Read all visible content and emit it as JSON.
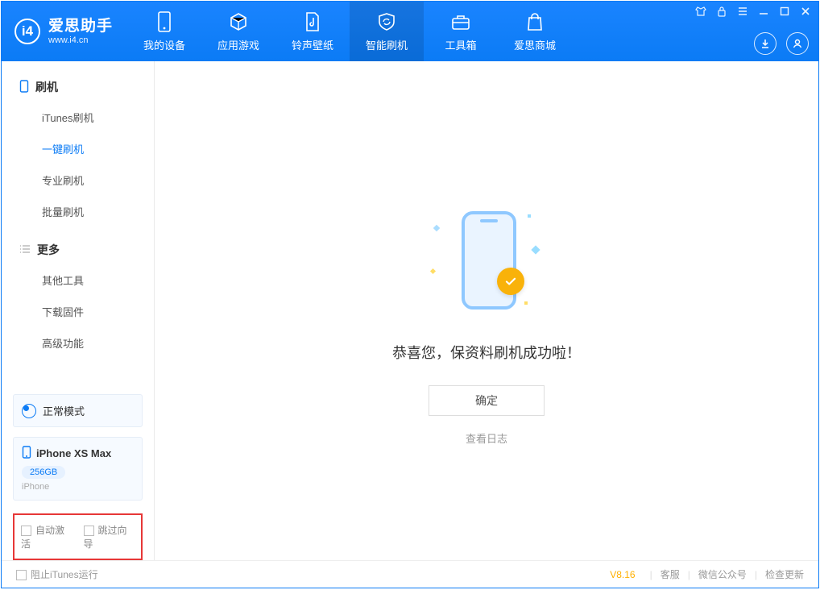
{
  "app": {
    "name_cn": "爱思助手",
    "name_en": "www.i4.cn"
  },
  "nav": {
    "items": [
      {
        "label": "我的设备"
      },
      {
        "label": "应用游戏"
      },
      {
        "label": "铃声壁纸"
      },
      {
        "label": "智能刷机"
      },
      {
        "label": "工具箱"
      },
      {
        "label": "爱思商城"
      }
    ],
    "active_index": 3
  },
  "sidebar": {
    "group1": {
      "title": "刷机",
      "items": [
        "iTunes刷机",
        "一键刷机",
        "专业刷机",
        "批量刷机"
      ],
      "active_index": 1
    },
    "group2": {
      "title": "更多",
      "items": [
        "其他工具",
        "下载固件",
        "高级功能"
      ]
    },
    "mode": {
      "label": "正常模式"
    },
    "device": {
      "name": "iPhone XS Max",
      "storage": "256GB",
      "subtype": "iPhone"
    },
    "options": {
      "auto_activate": "自动激活",
      "skip_guide": "跳过向导"
    }
  },
  "main": {
    "success_title": "恭喜您，保资料刷机成功啦！",
    "ok_button": "确定",
    "view_log": "查看日志"
  },
  "footer": {
    "block_itunes": "阻止iTunes运行",
    "version": "V8.16",
    "links": [
      "客服",
      "微信公众号",
      "检查更新"
    ]
  }
}
